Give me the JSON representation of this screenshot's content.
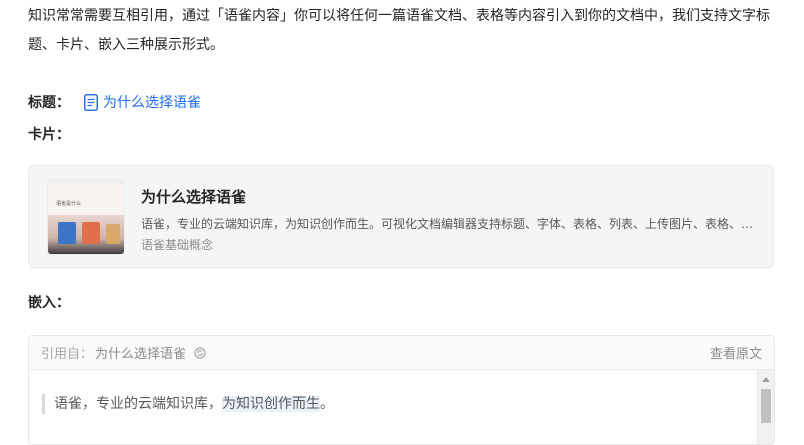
{
  "intro": "知识常常需要互相引用，通过「语雀内容」你可以将任何一篇语雀文档、表格等内容引入到你的文档中，我们支持文字标题、卡片、嵌入三种展示形式。",
  "title_row": {
    "label": "标题：",
    "link_text": "为什么选择语雀"
  },
  "card_row": {
    "label": "卡片："
  },
  "card": {
    "thumb_text": "语雀是什么",
    "title": "为什么选择语雀",
    "description": "语雀，专业的云端知识库，为知识创作而生。可视化文档编辑器支持标题、字体、表格、列表、上传图片、表格、…",
    "meta": "语雀基础概念"
  },
  "embed_row": {
    "label": "嵌入："
  },
  "embed": {
    "from_prefix": "引用自：",
    "doc_name": "为什么选择语雀",
    "view_source": "查看原文",
    "quote_plain": "语雀，专业的云端知识库，",
    "quote_highlight": "为知识创作而生",
    "quote_end": "。"
  },
  "colors": {
    "link": "#1f6ef2",
    "highlight": "#eaf1fb",
    "card_bg": "#f4f5f5"
  },
  "icons": {
    "doc": "doc-icon",
    "sync": "sync-icon",
    "scroll_up": "chevron-up-icon"
  }
}
